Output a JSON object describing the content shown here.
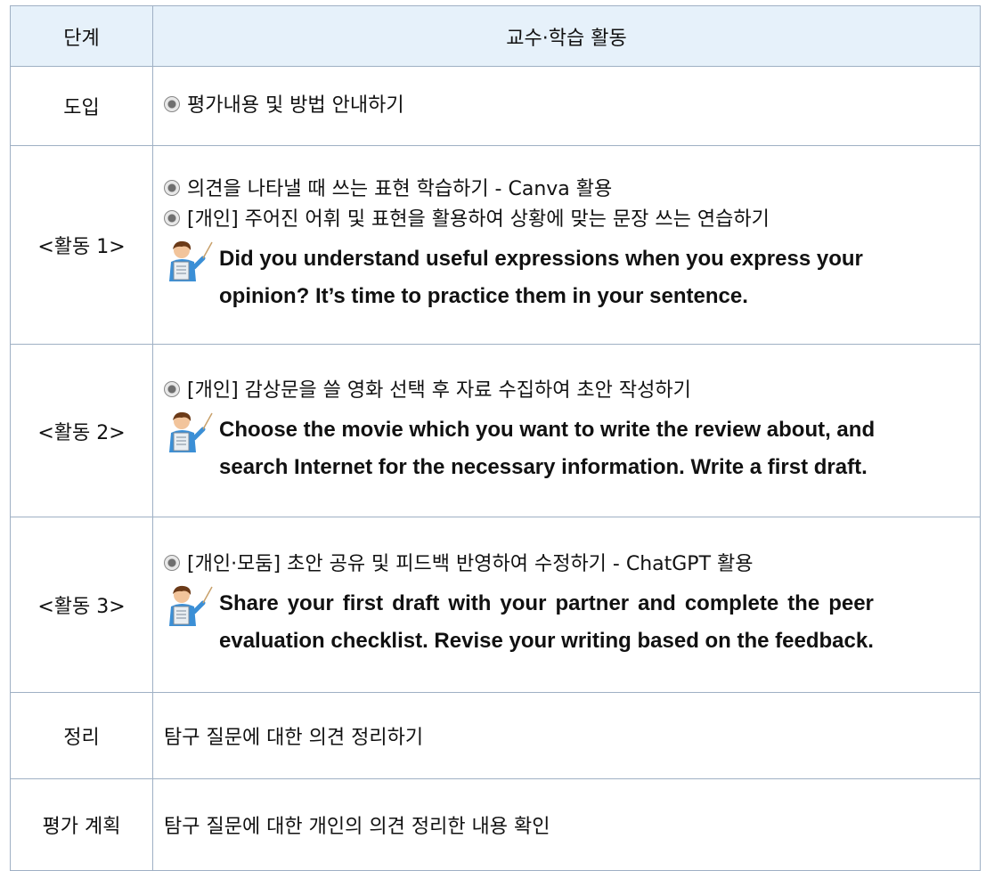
{
  "header": {
    "stage": "단계",
    "activity": "교수·학습 활동"
  },
  "rows": [
    {
      "stage": "도입",
      "items": [
        "평가내용 및 방법 안내하기"
      ]
    },
    {
      "stage": "<활동 1>",
      "items": [
        "의견을 나타낼 때 쓰는 표현 학습하기 - Canva 활용",
        "[개인] 주어진 어휘 및 표현을 활용하여 상황에 맞는 문장 쓰는 연습하기"
      ],
      "english": [
        "Did you understand useful expressions when you express your",
        "opinion? It’s time to practice them in your sentence."
      ]
    },
    {
      "stage": "<활동 2>",
      "items": [
        "[개인] 감상문을 쓸 영화 선택 후 자료 수집하여 초안 작성하기"
      ],
      "english": [
        "Choose the movie which you want to write the review about, and",
        "search Internet for the necessary information. Write a first draft."
      ]
    },
    {
      "stage": "<활동 3>",
      "items": [
        "[개인·모둠] 초안 공유 및 피드백 반영하여 수정하기 - ChatGPT 활용"
      ],
      "english": [
        "Share your first draft with your partner and complete the peer",
        "evaluation checklist. Revise your writing based on the feedback."
      ]
    },
    {
      "stage": "정리",
      "text": "탐구 질문에 대한 의견 정리하기"
    },
    {
      "stage": "평가 계획",
      "text": "탐구 질문에 대한 개인의 의견 정리한 내용 확인"
    }
  ],
  "icons": {
    "bullet": "circle-bullet-icon",
    "teacher": "teacher-pointer-icon"
  },
  "colors": {
    "header_bg": "#e6f1fa",
    "border": "#9fb0c4"
  }
}
